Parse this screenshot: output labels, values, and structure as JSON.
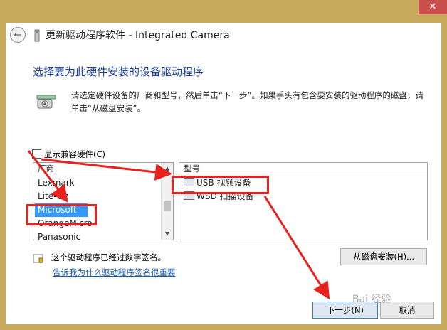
{
  "window": {
    "title": "更新驱动程序软件 - Integrated Camera",
    "close_glyph": "✕"
  },
  "main": {
    "heading": "选择要为此硬件安装的设备驱动程序",
    "description": "请选定硬件设备的厂商和型号，然后单击“下一步”。如果手头有包含要安装的驱动程序的磁盘，请单击“从磁盘安装”。",
    "show_compatible_label": "显示兼容硬件(C)",
    "show_compatible_checked": false
  },
  "manufacturer_list": {
    "header": "厂商",
    "items": [
      "Lexmark",
      "Lite-On",
      "Microsoft",
      "OrangeMicro",
      "Panasonic"
    ],
    "selected": "Microsoft"
  },
  "model_list": {
    "header": "型号",
    "items": [
      "USB 视频设备",
      "WSD 扫描设备"
    ]
  },
  "footer": {
    "signed_text": "这个驱动程序已经过数字签名。",
    "signing_link": "告诉我为什么驱动程序签名很重要",
    "have_disk_button": "从磁盘安装(H)...",
    "next_button": "下一步(N)",
    "cancel_button": "取消"
  },
  "watermark": "Bai 经验",
  "colors": {
    "heading": "#1a3f9a",
    "selection": "#3399ff",
    "annotation": "#e8211e",
    "frame": "#c8ab5c"
  }
}
